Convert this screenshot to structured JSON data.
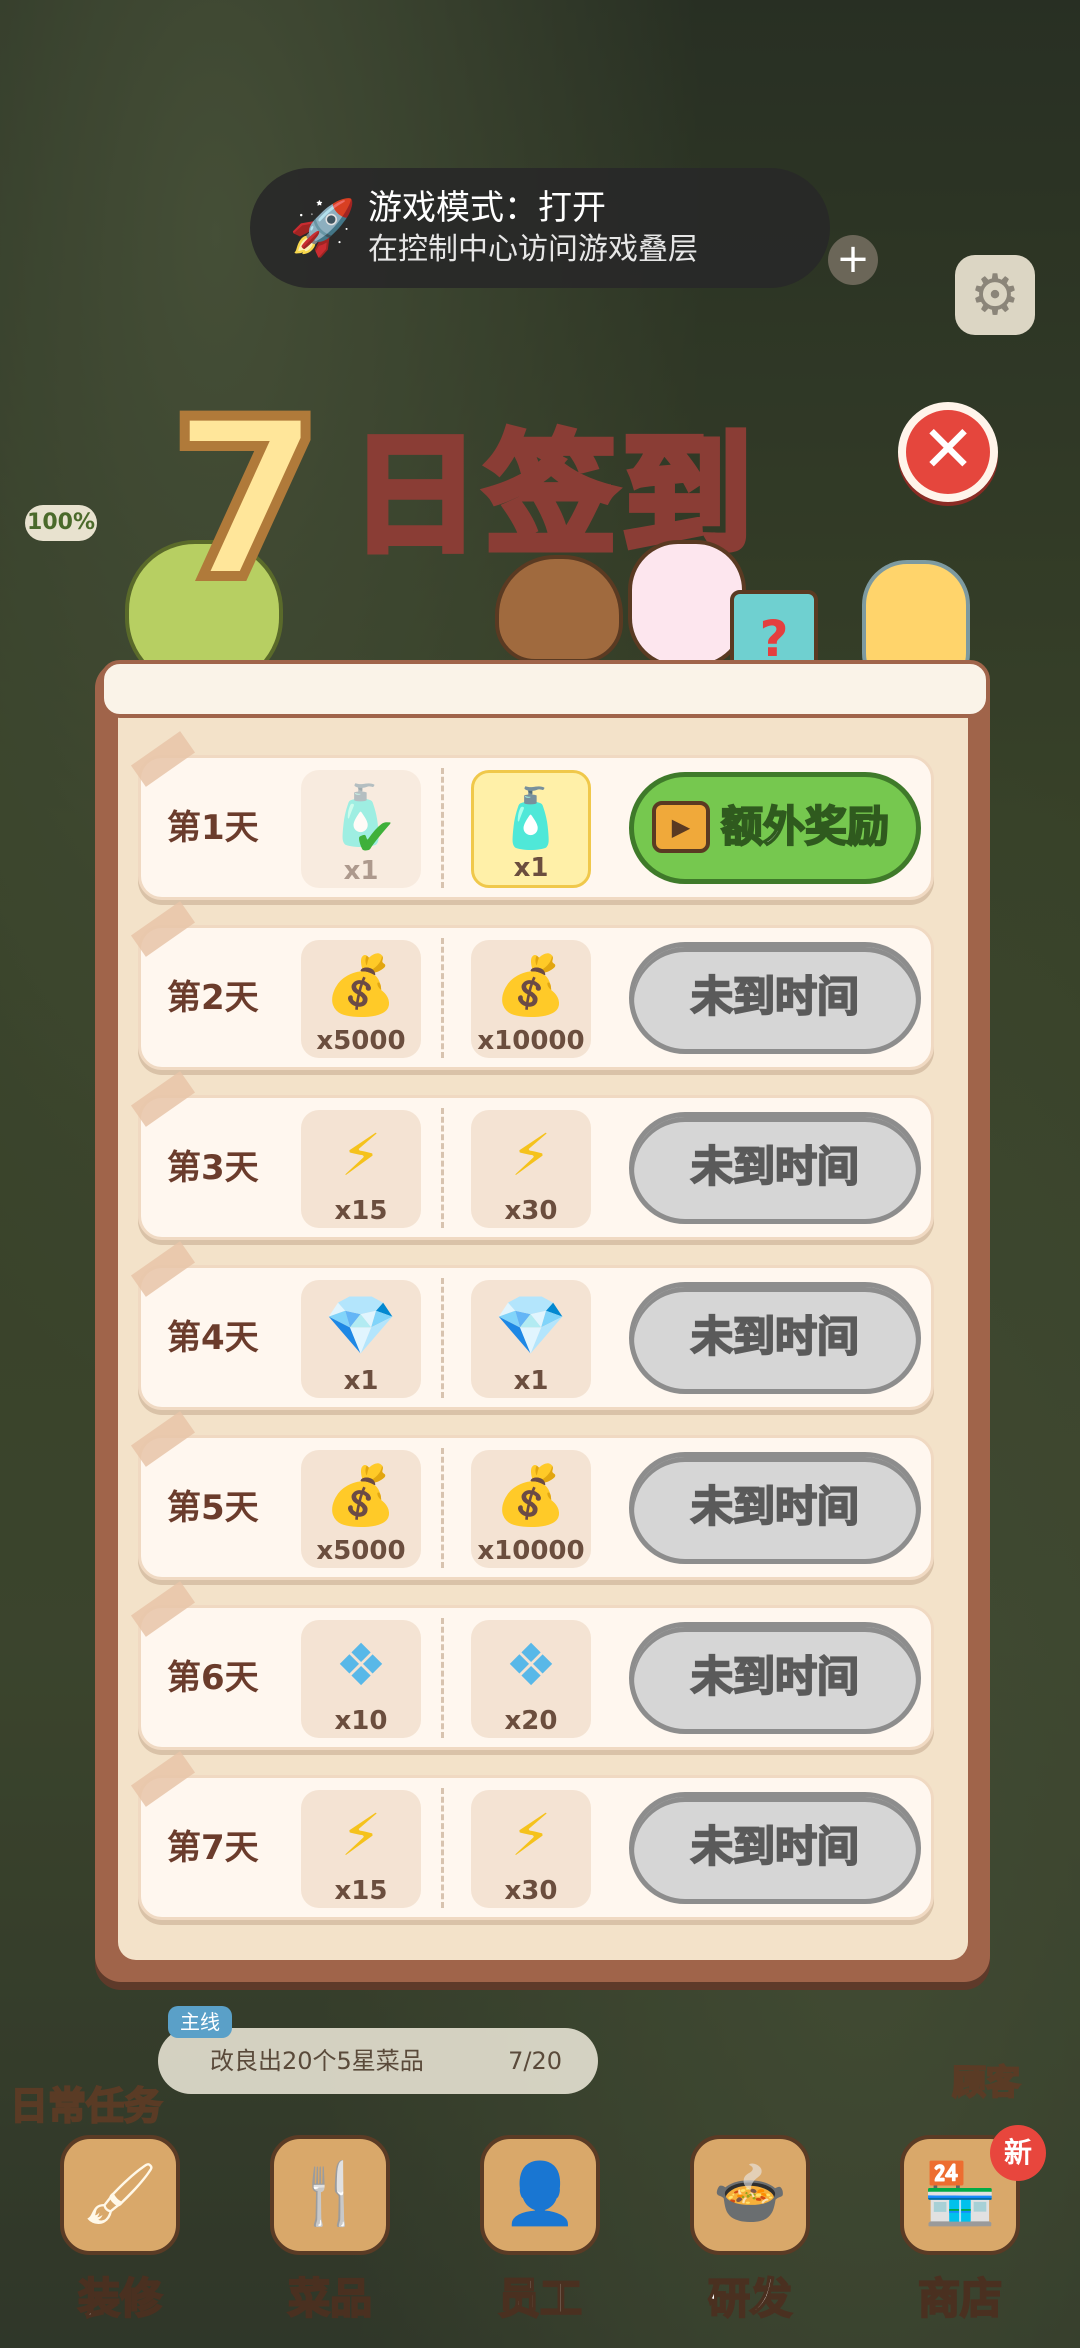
{
  "toast": {
    "title": "游戏模式：打开",
    "subtitle": "在控制中心访问游戏叠层"
  },
  "hud": {
    "progress_label": "100%"
  },
  "title": {
    "number": "7",
    "text": "日签到"
  },
  "rows": [
    {
      "day": "第1天",
      "left_qty": "x1",
      "right_qty": "x1",
      "button": "额外奖励"
    },
    {
      "day": "第2天",
      "left_qty": "x5000",
      "right_qty": "x10000",
      "button": "未到时间"
    },
    {
      "day": "第3天",
      "left_qty": "x15",
      "right_qty": "x30",
      "button": "未到时间"
    },
    {
      "day": "第4天",
      "left_qty": "x1",
      "right_qty": "x1",
      "button": "未到时间"
    },
    {
      "day": "第5天",
      "left_qty": "x5000",
      "right_qty": "x10000",
      "button": "未到时间"
    },
    {
      "day": "第6天",
      "left_qty": "x10",
      "right_qty": "x20",
      "button": "未到时间"
    },
    {
      "day": "第7天",
      "left_qty": "x15",
      "right_qty": "x30",
      "button": "未到时间"
    }
  ],
  "quest": {
    "tag": "主线",
    "text": "改良出20个5星菜品",
    "progress": "7/20"
  },
  "side": {
    "daily": "日常任务",
    "customer": "顾客"
  },
  "nav": {
    "decorate": "装修",
    "dishes": "菜品",
    "staff": "员工",
    "research": "研发",
    "shop": "商店",
    "new_badge": "新"
  }
}
